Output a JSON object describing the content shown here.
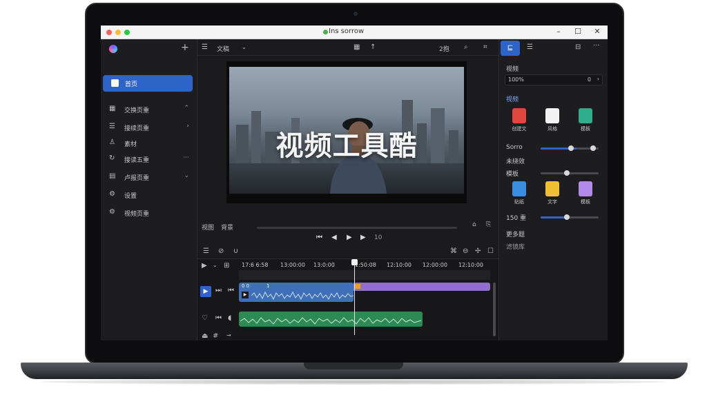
{
  "window": {
    "title": "Ins sorrow"
  },
  "sidebar": {
    "items": [
      {
        "label": "首页",
        "icon": "home-icon",
        "active": true
      },
      {
        "label": "交换页重",
        "icon": "grid-icon",
        "chevron": "⌃"
      },
      {
        "label": "接续页重",
        "icon": "list-icon",
        "chevron": "›"
      },
      {
        "label": "素材",
        "icon": "user-icon"
      },
      {
        "label": "接读五重",
        "icon": "refresh-icon",
        "chevron": "···"
      },
      {
        "label": "卢报页重",
        "icon": "layers-icon",
        "chevron": "⌄"
      },
      {
        "label": "设置",
        "icon": "gear-icon"
      },
      {
        "label": "视频页重",
        "icon": "gear-icon"
      }
    ]
  },
  "toolbar": {
    "file_menu": "文稿",
    "zoom": "2抱"
  },
  "preview": {
    "overlay_text": "视频工具酷",
    "label_a": "视图",
    "label_b": "背景",
    "frame_count": "10"
  },
  "timeline": {
    "ruler_marks": [
      "17:6 6:58",
      "13:00:00",
      "13:0:00",
      "1:50:08",
      "12:10:00",
      "12:00:00",
      "12:10:00"
    ],
    "clip_v1_label": "0 0",
    "clip_v1_num": "1"
  },
  "right_panel": {
    "section1": "视频",
    "field_value": "100%",
    "field_right": "0",
    "section2": "视频",
    "effects_row1": [
      {
        "label": "创建文",
        "color": "#e0483e"
      },
      {
        "label": "风格",
        "color": "#f2f2f2"
      },
      {
        "label": "模板",
        "color": "#2fae8c"
      }
    ],
    "slider_a_label": "Sorro",
    "slider_a_value": 0.62,
    "slider_b_label": "未绕效",
    "slider_b_title": "模板",
    "slider_b_value": 0.5,
    "effects_row2": [
      {
        "label": "贴纸",
        "color": "#3a8fe0"
      },
      {
        "label": "文字",
        "color": "#f0c030"
      },
      {
        "label": "模板",
        "color": "#b48ae8"
      }
    ],
    "slider_c_label": "150 重",
    "slider_c_value": 0.46,
    "section3": "更多题",
    "section4": "滤镜库"
  }
}
